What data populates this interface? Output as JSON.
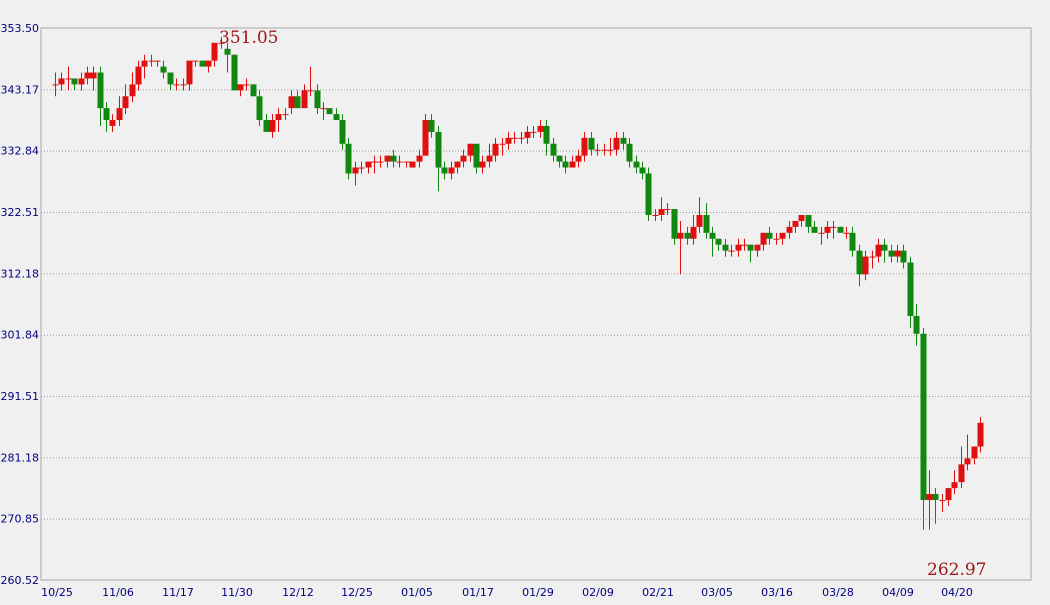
{
  "chart_data": {
    "type": "candlestick",
    "y_ticks": [
      "353.50",
      "343.17",
      "332.84",
      "322.51",
      "312.18",
      "301.84",
      "291.51",
      "281.18",
      "270.85",
      "260.52"
    ],
    "ylim": [
      260.52,
      353.5
    ],
    "x_ticks": [
      "10/25",
      "11/06",
      "11/17",
      "11/30",
      "12/12",
      "12/25",
      "01/05",
      "01/17",
      "01/29",
      "02/09",
      "02/21",
      "03/05",
      "03/16",
      "03/28",
      "04/09",
      "04/20"
    ],
    "grid": "horizontal-dotted",
    "annotations": [
      {
        "text": "351.05",
        "kind": "high"
      },
      {
        "text": "262.97",
        "kind": "low"
      }
    ],
    "colors": {
      "up": "#e01010",
      "down": "#108810",
      "annotation": "#a01818",
      "tick": "#000080"
    },
    "candles": [
      [
        344,
        346,
        342,
        344
      ],
      [
        344,
        346,
        343,
        345
      ],
      [
        345,
        347,
        343,
        345
      ],
      [
        345,
        345,
        343,
        344
      ],
      [
        344,
        346,
        343,
        345
      ],
      [
        345,
        347,
        344,
        346
      ],
      [
        345,
        347,
        343,
        346
      ],
      [
        346,
        347,
        337,
        340
      ],
      [
        340,
        341,
        336,
        338
      ],
      [
        337,
        339,
        336,
        338
      ],
      [
        338,
        342,
        337,
        340
      ],
      [
        340,
        344,
        339,
        342
      ],
      [
        342,
        346,
        341,
        344
      ],
      [
        344,
        348,
        343,
        347
      ],
      [
        347,
        349,
        345,
        348
      ],
      [
        348,
        349,
        347,
        348
      ],
      [
        348,
        348,
        347,
        348
      ],
      [
        347,
        348,
        345,
        346
      ],
      [
        346,
        346,
        343,
        344
      ],
      [
        344,
        345,
        343,
        344
      ],
      [
        344,
        345,
        343,
        344
      ],
      [
        344,
        348,
        343,
        348
      ],
      [
        348,
        348,
        347,
        348
      ],
      [
        348,
        348,
        347,
        347
      ],
      [
        347,
        348,
        346,
        348
      ],
      [
        348,
        351,
        347,
        351
      ],
      [
        351,
        352,
        350,
        351
      ],
      [
        350,
        351,
        346,
        349
      ],
      [
        349,
        349,
        343,
        343
      ],
      [
        343,
        344,
        342,
        344
      ],
      [
        344,
        345,
        343,
        344
      ],
      [
        344,
        344,
        342,
        342
      ],
      [
        342,
        343,
        337,
        338
      ],
      [
        338,
        339,
        336,
        336
      ],
      [
        336,
        339,
        335,
        338
      ],
      [
        338,
        340,
        336,
        339
      ],
      [
        339,
        340,
        338,
        339
      ],
      [
        340,
        343,
        339,
        342
      ],
      [
        342,
        343,
        340,
        340
      ],
      [
        340,
        344,
        340,
        343
      ],
      [
        343,
        347,
        342,
        343
      ],
      [
        343,
        344,
        339,
        340
      ],
      [
        340,
        341,
        338,
        340
      ],
      [
        340,
        340,
        339,
        339
      ],
      [
        339,
        340,
        338,
        338
      ],
      [
        338,
        339,
        333,
        334
      ],
      [
        334,
        335,
        328,
        329
      ],
      [
        329,
        331,
        327,
        330
      ],
      [
        330,
        331,
        329,
        330
      ],
      [
        330,
        331,
        329,
        331
      ],
      [
        331,
        332,
        329,
        331
      ],
      [
        331,
        332,
        330,
        331
      ],
      [
        331,
        332,
        330,
        332
      ],
      [
        332,
        333,
        330,
        331
      ],
      [
        331,
        332,
        330,
        331
      ],
      [
        331,
        331,
        330,
        331
      ],
      [
        330,
        331,
        330,
        331
      ],
      [
        331,
        333,
        330,
        332
      ],
      [
        332,
        339,
        332,
        338
      ],
      [
        338,
        339,
        335,
        336
      ],
      [
        336,
        337,
        326,
        330
      ],
      [
        330,
        331,
        328,
        329
      ],
      [
        329,
        331,
        328,
        330
      ],
      [
        330,
        331,
        329,
        331
      ],
      [
        331,
        333,
        330,
        332
      ],
      [
        332,
        334,
        331,
        334
      ],
      [
        334,
        334,
        329,
        330
      ],
      [
        330,
        332,
        329,
        331
      ],
      [
        331,
        334,
        330,
        332
      ],
      [
        332,
        335,
        331,
        334
      ],
      [
        334,
        335,
        332,
        334
      ],
      [
        334,
        336,
        333,
        335
      ],
      [
        335,
        336,
        334,
        335
      ],
      [
        335,
        336,
        334,
        335
      ],
      [
        335,
        337,
        334,
        336
      ],
      [
        336,
        337,
        335,
        336
      ],
      [
        336,
        338,
        335,
        337
      ],
      [
        337,
        338,
        332,
        334
      ],
      [
        334,
        335,
        331,
        332
      ],
      [
        332,
        332,
        330,
        331
      ],
      [
        331,
        332,
        329,
        330
      ],
      [
        330,
        332,
        330,
        331
      ],
      [
        331,
        333,
        330,
        332
      ],
      [
        332,
        336,
        331,
        335
      ],
      [
        335,
        336,
        332,
        333
      ],
      [
        333,
        334,
        332,
        333
      ],
      [
        333,
        334,
        332,
        333
      ],
      [
        333,
        335,
        332,
        333
      ],
      [
        333,
        336,
        332,
        335
      ],
      [
        335,
        336,
        333,
        334
      ],
      [
        334,
        335,
        330,
        331
      ],
      [
        331,
        332,
        329,
        330
      ],
      [
        330,
        331,
        328,
        329
      ],
      [
        329,
        330,
        321,
        322
      ],
      [
        322,
        323,
        321,
        322
      ],
      [
        322,
        325,
        321,
        323
      ],
      [
        323,
        324,
        322,
        323
      ],
      [
        323,
        323,
        317,
        318
      ],
      [
        318,
        321,
        312,
        319
      ],
      [
        319,
        320,
        317,
        318
      ],
      [
        318,
        322,
        317,
        320
      ],
      [
        320,
        325,
        319,
        322
      ],
      [
        322,
        324,
        318,
        319
      ],
      [
        319,
        320,
        315,
        318
      ],
      [
        318,
        318,
        316,
        317
      ],
      [
        317,
        318,
        315,
        316
      ],
      [
        316,
        317,
        315,
        316
      ],
      [
        316,
        318,
        315,
        317
      ],
      [
        317,
        318,
        316,
        317
      ],
      [
        317,
        317,
        314,
        316
      ],
      [
        316,
        317,
        315,
        317
      ],
      [
        317,
        319,
        316,
        319
      ],
      [
        319,
        320,
        317,
        318
      ],
      [
        318,
        319,
        317,
        318
      ],
      [
        318,
        319,
        317,
        319
      ],
      [
        319,
        321,
        318,
        320
      ],
      [
        320,
        321,
        319,
        321
      ],
      [
        321,
        322,
        320,
        322
      ],
      [
        322,
        322,
        319,
        320
      ],
      [
        320,
        321,
        319,
        319
      ],
      [
        319,
        320,
        317,
        319
      ],
      [
        319,
        321,
        318,
        320
      ],
      [
        320,
        321,
        318,
        320
      ],
      [
        320,
        320,
        319,
        319
      ],
      [
        319,
        320,
        318,
        319
      ],
      [
        319,
        320,
        315,
        316
      ],
      [
        316,
        317,
        310,
        312
      ],
      [
        312,
        316,
        311,
        315
      ],
      [
        315,
        316,
        313,
        315
      ],
      [
        315,
        318,
        314,
        317
      ],
      [
        317,
        318,
        314,
        316
      ],
      [
        316,
        317,
        314,
        315
      ],
      [
        315,
        317,
        314,
        316
      ],
      [
        316,
        317,
        313,
        314
      ],
      [
        314,
        315,
        303,
        305
      ],
      [
        305,
        307,
        300,
        302
      ],
      [
        302,
        303,
        269,
        274
      ],
      [
        274,
        279,
        269,
        275
      ],
      [
        275,
        276,
        270,
        274
      ],
      [
        274,
        275,
        272,
        274
      ],
      [
        274,
        276,
        273,
        276
      ],
      [
        276,
        279,
        275,
        277
      ],
      [
        277,
        283,
        276,
        280
      ],
      [
        280,
        285,
        279,
        281
      ],
      [
        281,
        283,
        280,
        283
      ],
      [
        283,
        288,
        282,
        287
      ]
    ]
  }
}
